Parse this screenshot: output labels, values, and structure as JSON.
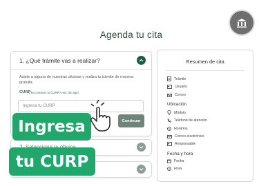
{
  "page": {
    "title": "Agenda tu cita"
  },
  "step1": {
    "title": "1. ¿Qué trámite vas a realizar?",
    "description": "Asiste a alguna de nuestras oficinas y realiza tu trámite de manera gratuita.",
    "curp_label": "CURP",
    "curp_link": "¿No conoces tu CURP? Haz clic aquí",
    "curp_placeholder": "Ingresa tu CURP",
    "continue_label": "Continuar"
  },
  "step2": {
    "title": "2. Selecciona la oficina"
  },
  "summary": {
    "title": "Resumen de cita",
    "tramite": "Trámite",
    "usuario": "Usuario",
    "correo": "Correo",
    "ubicacion_heading": "Ubicación",
    "modulo": "Módulo",
    "telefono": "Teléfono de atención",
    "horarios": "Horarios",
    "correo_electronico": "Correo electrónico",
    "responsable": "Responsable",
    "fecha_heading": "Fecha y hora",
    "fecha": "Fecha",
    "hora": "Hora"
  },
  "overlay": {
    "line1": "Ingresa",
    "line2": "tu CURP"
  },
  "colors": {
    "brand_green": "#1f5c46",
    "overlay_green": "#21a66b",
    "button_gray_green": "#6f857c"
  }
}
